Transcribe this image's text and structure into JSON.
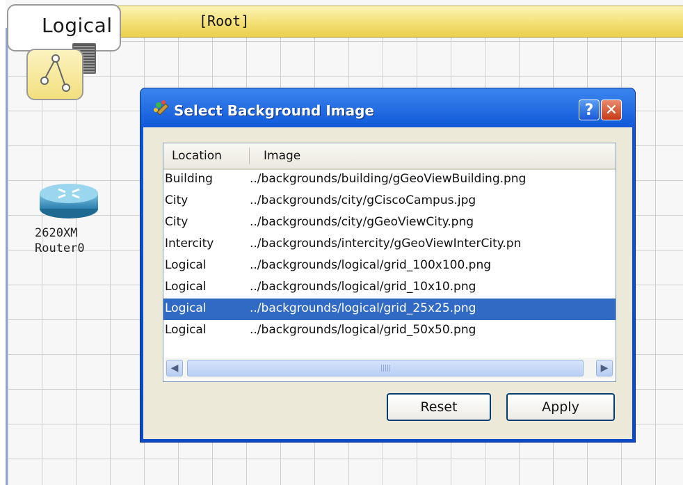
{
  "workspace": {
    "tab_label": "Logical",
    "path_label": "[Root]"
  },
  "device": {
    "model": "2620XM",
    "name": "Router0"
  },
  "dialog": {
    "title": "Select Background Image",
    "help_label": "?",
    "close_label": "✕",
    "columns": [
      "Location",
      "Image"
    ],
    "rows": [
      {
        "location": "Building",
        "image": "../backgrounds/building/gGeoViewBuilding.png",
        "selected": false
      },
      {
        "location": "City",
        "image": "../backgrounds/city/gCiscoCampus.jpg",
        "selected": false
      },
      {
        "location": "City",
        "image": "../backgrounds/city/gGeoViewCity.png",
        "selected": false
      },
      {
        "location": "Intercity",
        "image": "../backgrounds/intercity/gGeoViewInterCity.pn",
        "selected": false
      },
      {
        "location": "Logical",
        "image": "../backgrounds/logical/grid_100x100.png",
        "selected": false
      },
      {
        "location": "Logical",
        "image": "../backgrounds/logical/grid_10x10.png",
        "selected": false
      },
      {
        "location": "Logical",
        "image": "../backgrounds/logical/grid_25x25.png",
        "selected": true
      },
      {
        "location": "Logical",
        "image": "../backgrounds/logical/grid_50x50.png",
        "selected": false
      }
    ],
    "reset_label": "Reset",
    "apply_label": "Apply"
  },
  "colors": {
    "title_bar": "#0a4ac6",
    "selection": "#316ac5",
    "top_bar": "#f4e27a"
  }
}
